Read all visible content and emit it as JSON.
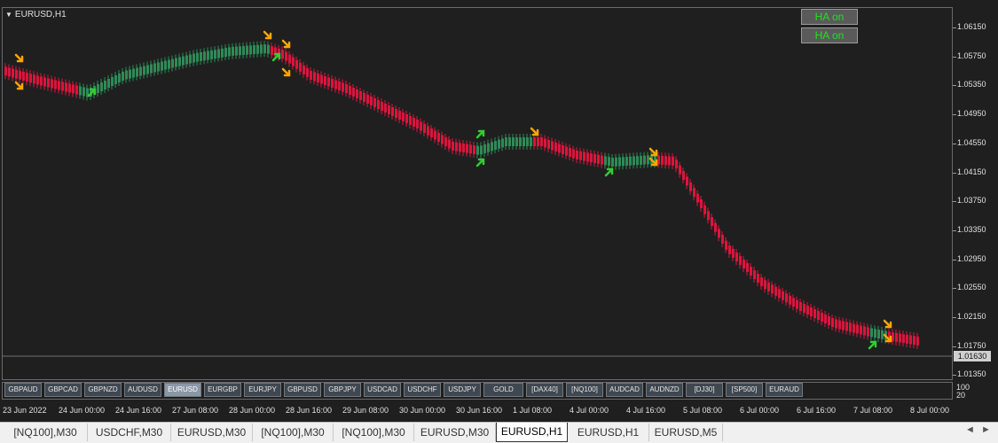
{
  "chart": {
    "title": "EURUSD,H1",
    "current_price": "1.01630",
    "ha_buttons": [
      "HA on",
      "HA on"
    ],
    "colors": {
      "bull": "#2e8b57",
      "bear": "#dc143c",
      "buy_arrow": "#32cd32",
      "sell_arrow": "#ffa500",
      "background": "#1f1f1f"
    },
    "y_ticks": [
      "1.06150",
      "1.05750",
      "1.05350",
      "1.04950",
      "1.04550",
      "1.04150",
      "1.03750",
      "1.03350",
      "1.02950",
      "1.02550",
      "1.02150",
      "1.01750",
      "1.01350"
    ],
    "sub_scale": [
      "100",
      "20"
    ],
    "x_ticks": [
      "23 Jun 2022",
      "24 Jun 00:00",
      "24 Jun 16:00",
      "27 Jun 08:00",
      "28 Jun 00:00",
      "28 Jun 16:00",
      "29 Jun 08:00",
      "30 Jun 00:00",
      "30 Jun 16:00",
      "1 Jul 08:00",
      "4 Jul 00:00",
      "4 Jul 16:00",
      "5 Jul 08:00",
      "6 Jul 00:00",
      "6 Jul 16:00",
      "7 Jul 08:00",
      "8 Jul 00:00"
    ]
  },
  "symbols": [
    "GBPAUD",
    "GBPCAD",
    "GBPNZD",
    "AUDUSD",
    "EURUSD",
    "EURGBP",
    "EURJPY",
    "GBPUSD",
    "GBPJPY",
    "USDCAD",
    "USDCHF",
    "USDJPY",
    "GOLD",
    "[DAX40]",
    "[NQ100]",
    "AUDCAD",
    "AUDNZD",
    "[DJ30]",
    "[SP500]",
    "EURAUD"
  ],
  "active_symbol": "EURUSD",
  "tabs": [
    "[NQ100],M30",
    "USDCHF,M30",
    "EURUSD,M30",
    "[NQ100],M30",
    "[NQ100],M30",
    "EURUSD,M30",
    "EURUSD,H1",
    "EURUSD,H1",
    "EURUSD,M5"
  ],
  "active_tab_index": 6,
  "tab_scroll": {
    "left": "◄",
    "right": "►"
  }
}
